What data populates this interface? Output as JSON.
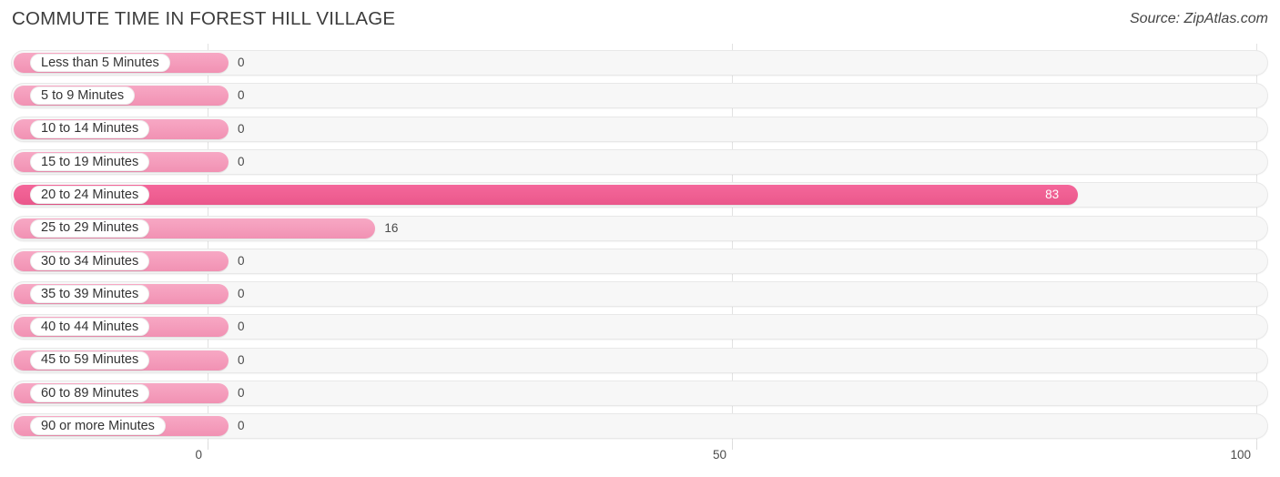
{
  "header": {
    "title": "COMMUTE TIME IN FOREST HILL VILLAGE",
    "source": "Source: ZipAtlas.com"
  },
  "axis": {
    "ticks": [
      "0",
      "50",
      "100"
    ]
  },
  "colors": {
    "bar_light": "#f4a0bd",
    "bar_dark": "#f0608f",
    "track": "#f7f7f7",
    "grid": "#e2e2e2",
    "text": "#333333"
  },
  "chart_data": {
    "type": "bar",
    "orientation": "horizontal",
    "title": "COMMUTE TIME IN FOREST HILL VILLAGE",
    "xlabel": "",
    "ylabel": "",
    "xlim": [
      0,
      100
    ],
    "xticks": [
      0,
      50,
      100
    ],
    "grid": true,
    "legend": "none",
    "source": "Source: ZipAtlas.com",
    "categories": [
      "Less than 5 Minutes",
      "5 to 9 Minutes",
      "10 to 14 Minutes",
      "15 to 19 Minutes",
      "20 to 24 Minutes",
      "25 to 29 Minutes",
      "30 to 34 Minutes",
      "35 to 39 Minutes",
      "40 to 44 Minutes",
      "45 to 59 Minutes",
      "60 to 89 Minutes",
      "90 or more Minutes"
    ],
    "values": [
      0,
      0,
      0,
      0,
      83,
      16,
      0,
      0,
      0,
      0,
      0,
      0
    ],
    "value_labels": [
      "0",
      "0",
      "0",
      "0",
      "83",
      "16",
      "0",
      "0",
      "0",
      "0",
      "0",
      "0"
    ],
    "highlight_index": 4
  }
}
